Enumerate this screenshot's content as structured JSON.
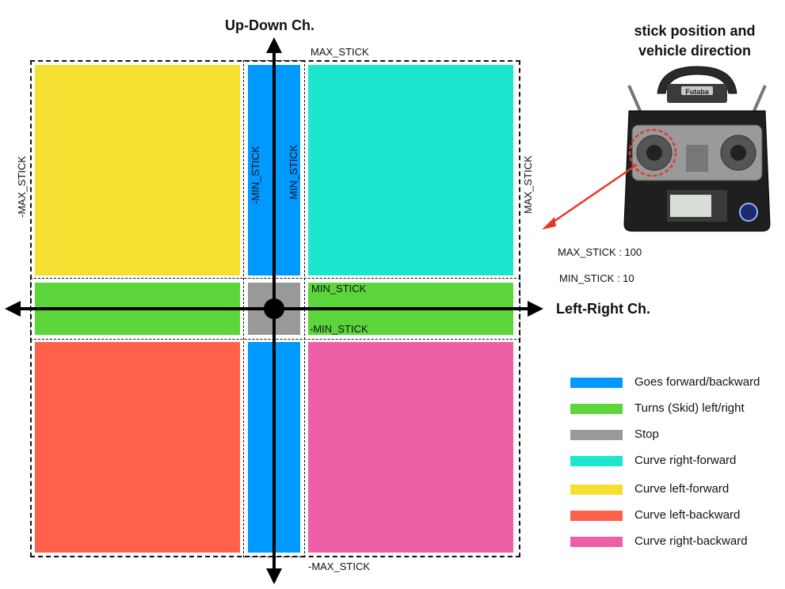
{
  "axes": {
    "vertical_title": "Up-Down Ch.",
    "horizontal_title": "Left-Right Ch."
  },
  "labels": {
    "top_max": "MAX_STICK",
    "bottom_max": "-MAX_STICK",
    "left_max": "-MAX_STICK",
    "right_max": "MAX_STICK",
    "v_min_neg": "-MIN_STICK",
    "v_min_pos": "MIN_STICK",
    "h_min_pos": "MIN_STICK",
    "h_min_neg": "-MIN_STICK"
  },
  "inset": {
    "title_line1": "stick position and",
    "title_line2": "vehicle direction",
    "brand": "Futaba",
    "max_stick": "MAX_STICK : 100",
    "min_stick": "MIN_STICK : 10"
  },
  "colors": {
    "forward_backward": "#0099ff",
    "turns": "#5cd63a",
    "stop": "#999999",
    "curve_right_forward": "#1de6cf",
    "curve_left_forward": "#f5e032",
    "curve_left_backward": "#ff614a",
    "curve_right_backward": "#ef5fa8",
    "pointer": "#e03a2a"
  },
  "legend": [
    {
      "label": "Goes forward/backward",
      "color": "#0099ff"
    },
    {
      "label": "Turns (Skid) left/right",
      "color": "#5cd63a"
    },
    {
      "label": "Stop",
      "color": "#999999"
    },
    {
      "label": "Curve right-forward",
      "color": "#1de6cf"
    },
    {
      "label": "Curve left-forward",
      "color": "#f5e032"
    },
    {
      "label": "Curve left-backward",
      "color": "#ff614a"
    },
    {
      "label": "Curve right-backward",
      "color": "#ef5fa8"
    }
  ]
}
